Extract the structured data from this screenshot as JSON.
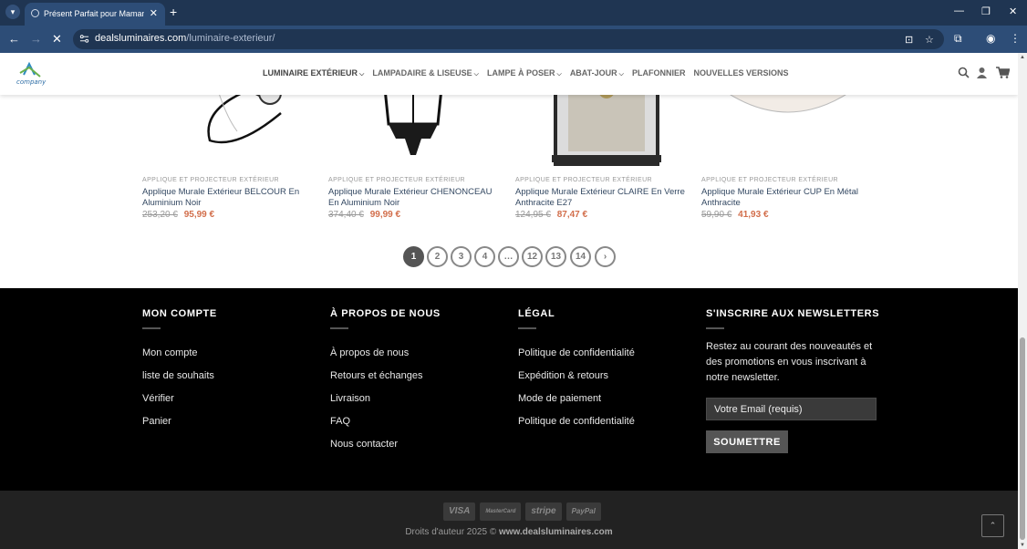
{
  "browser": {
    "tab_title": "Présent Parfait pour Maman : S",
    "url_domain": "dealsluminaires.com",
    "url_path": "/luminaire-exterieur/"
  },
  "header": {
    "logo_text": "company",
    "nav": [
      {
        "label": "LUMINAIRE EXTÉRIEUR",
        "has_dropdown": true
      },
      {
        "label": "LAMPADAIRE & LISEUSE",
        "has_dropdown": true
      },
      {
        "label": "LAMPE À POSER",
        "has_dropdown": true
      },
      {
        "label": "ABAT-JOUR",
        "has_dropdown": true
      },
      {
        "label": "PLAFONNIER",
        "has_dropdown": false
      },
      {
        "label": "NOUVELLES VERSIONS",
        "has_dropdown": false
      }
    ]
  },
  "products": [
    {
      "category": "APPLIQUE ET PROJECTEUR EXTÉRIEUR",
      "name": "Applique Murale Extérieur BELCOUR En Aluminium Noir",
      "old_price": "253,20 €",
      "price": "95,99 €"
    },
    {
      "category": "APPLIQUE ET PROJECTEUR EXTÉRIEUR",
      "name": "Applique Murale Extérieur CHENONCEAU En Aluminium Noir",
      "old_price": "374,40 €",
      "price": "99,99 €"
    },
    {
      "category": "APPLIQUE ET PROJECTEUR EXTÉRIEUR",
      "name": "Applique Murale Extérieur CLAIRE En Verre Anthracite E27",
      "old_price": "124,95 €",
      "price": "87,47 €"
    },
    {
      "category": "APPLIQUE ET PROJECTEUR EXTÉRIEUR",
      "name": "Applique Murale Extérieur CUP En Métal Anthracite",
      "old_price": "59,90 €",
      "price": "41,93 €"
    }
  ],
  "pagination": {
    "pages": [
      "1",
      "2",
      "3",
      "4",
      "…",
      "12",
      "13",
      "14"
    ],
    "current": "1"
  },
  "footer": {
    "account": {
      "title": "MON COMPTE",
      "links": [
        "Mon compte",
        "liste de souhaits",
        "Vérifier",
        "Panier"
      ]
    },
    "about": {
      "title": "À PROPOS DE NOUS",
      "links": [
        "À propos de nous",
        "Retours et échanges",
        "Livraison",
        "FAQ",
        "Nous contacter"
      ]
    },
    "legal": {
      "title": "LÉGAL",
      "links": [
        "Politique de confidentialité",
        "Expédition & retours",
        "Mode de paiement",
        "Politique de confidentialité"
      ]
    },
    "newsletter": {
      "title": "S'INSCRIRE AUX NEWSLETTERS",
      "text": "Restez au courant des nouveautés et des promotions en vous inscrivant à notre newsletter.",
      "placeholder": "Votre Email (requis)",
      "button": "SOUMETTRE"
    }
  },
  "bottom": {
    "payments": [
      "VISA",
      "MasterCard",
      "stripe",
      "PayPal"
    ],
    "copyright_prefix": "Droits d'auteur 2025 ©",
    "copyright_site": "www.dealsluminaires.com"
  },
  "colors": {
    "browser_bar": "#2d4d77",
    "sale_price": "#d26e4b",
    "product_link": "#334862",
    "footer_bg": "#000000"
  }
}
